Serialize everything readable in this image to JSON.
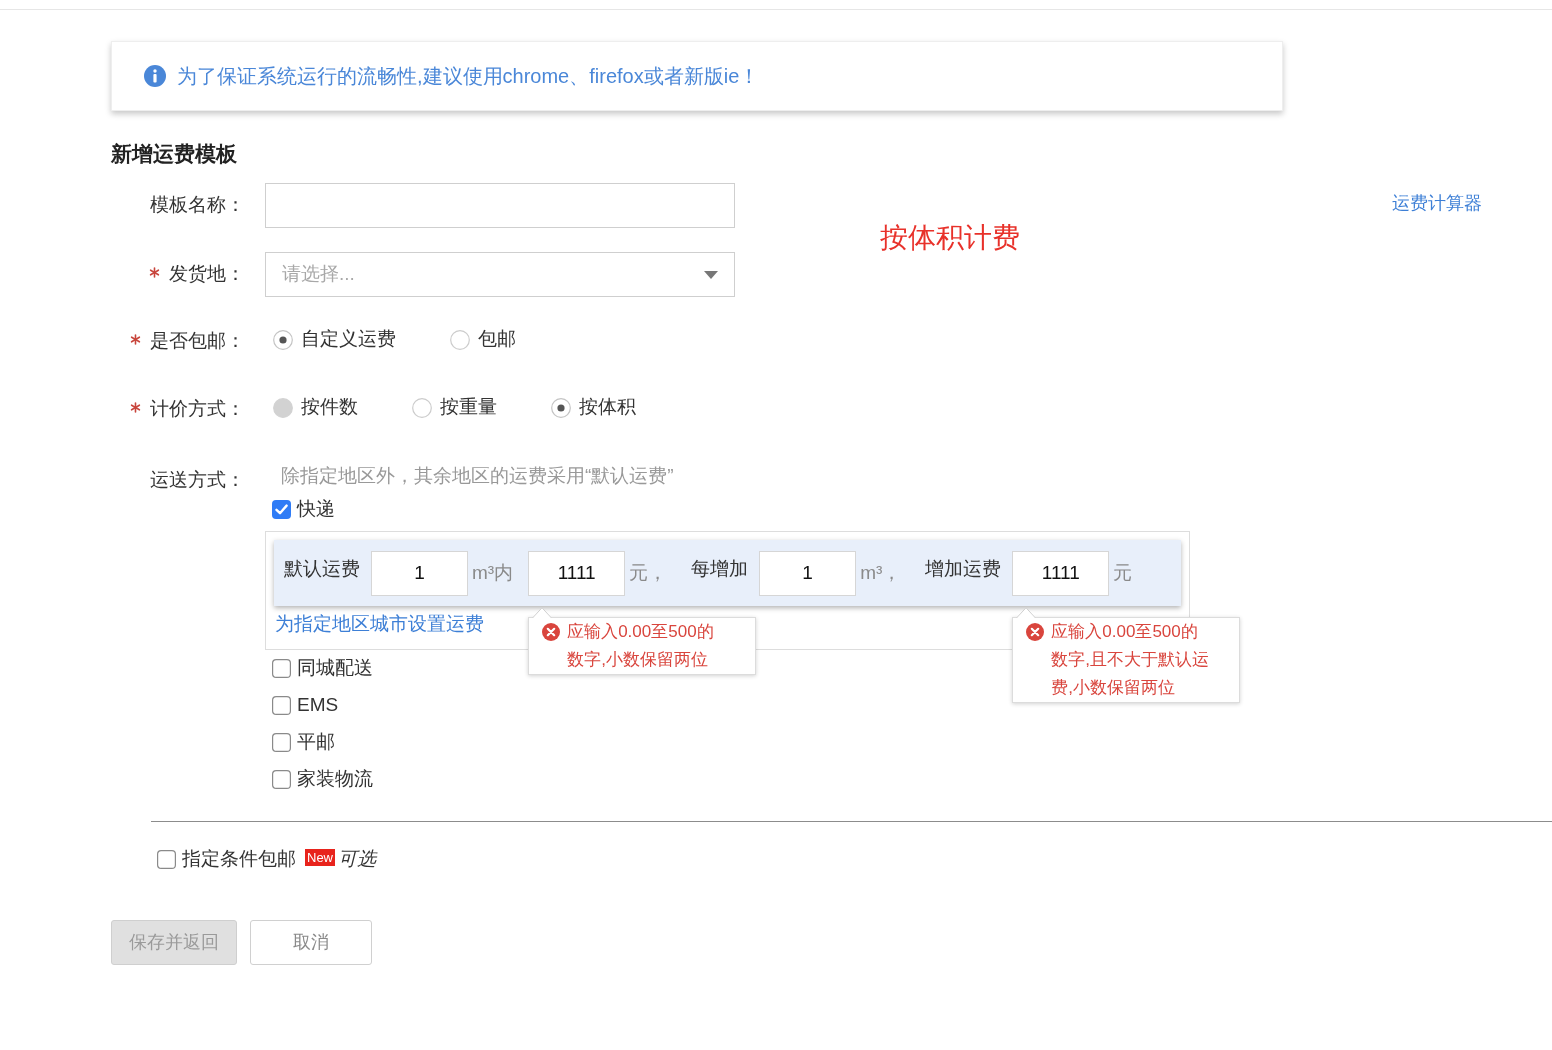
{
  "notice": {
    "text": "为了保证系统运行的流畅性,建议使用chrome、firefox或者新版ie！"
  },
  "page_title": "新增运费模板",
  "annotation": "按体积计费",
  "calculator_link": "运费计算器",
  "fields": [
    {
      "kind": "text",
      "label": "模板名称：",
      "required": false
    },
    {
      "kind": "select",
      "label": "发货地：",
      "required": true,
      "placeholder": "请选择..."
    },
    {
      "kind": "radio",
      "label": "是否包邮：",
      "required": true,
      "options": [
        {
          "label": "自定义运费",
          "selected": true,
          "disabled": false
        },
        {
          "label": "包邮",
          "selected": false,
          "disabled": false
        }
      ]
    },
    {
      "kind": "radio",
      "label": "计价方式：",
      "required": true,
      "options": [
        {
          "label": "按件数",
          "selected": false,
          "disabled": true
        },
        {
          "label": "按重量",
          "selected": false,
          "disabled": false
        },
        {
          "label": "按体积",
          "selected": true,
          "disabled": false
        }
      ]
    },
    {
      "kind": "shipping",
      "label": "运送方式：",
      "required": false,
      "hint": "除指定地区外，其余地区的运费采用“默认运费”",
      "methods": [
        {
          "label": "快递",
          "checked": true,
          "rates": [
            {
              "kind": "label",
              "text": "默认运费"
            },
            {
              "kind": "input",
              "value": "1"
            },
            {
              "kind": "unit",
              "text": "m³内"
            },
            {
              "kind": "input",
              "value": "1111",
              "error": "应输入0.00至500的数字,小数保留两位"
            },
            {
              "kind": "unit",
              "text": "元，"
            },
            {
              "kind": "label",
              "text": "每增加"
            },
            {
              "kind": "input",
              "value": "1"
            },
            {
              "kind": "unit",
              "text": "m³，"
            },
            {
              "kind": "label",
              "text": "增加运费"
            },
            {
              "kind": "input",
              "value": "1111",
              "error": "应输入0.00至500的数字,且不大于默认运费,小数保留两位"
            },
            {
              "kind": "unit",
              "text": "元"
            }
          ],
          "area_link": "为指定地区城市设置运费"
        },
        {
          "label": "同城配送",
          "checked": false
        },
        {
          "label": "EMS",
          "checked": false
        },
        {
          "label": "平邮",
          "checked": false
        },
        {
          "label": "家装物流",
          "checked": false
        }
      ]
    }
  ],
  "conditional_free_shipping": {
    "label": "指定条件包邮",
    "checked": false,
    "badge": "New",
    "note": "可选"
  },
  "buttons": [
    {
      "label": "保存并返回",
      "disabled": true
    },
    {
      "label": "取消",
      "disabled": false
    }
  ]
}
